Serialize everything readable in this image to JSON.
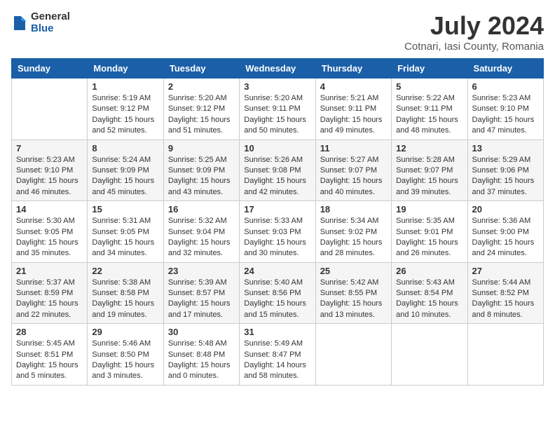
{
  "logo": {
    "general": "General",
    "blue": "Blue"
  },
  "title": "July 2024",
  "subtitle": "Cotnari, Iasi County, Romania",
  "days_of_week": [
    "Sunday",
    "Monday",
    "Tuesday",
    "Wednesday",
    "Thursday",
    "Friday",
    "Saturday"
  ],
  "weeks": [
    [
      {
        "day": "",
        "content": ""
      },
      {
        "day": "1",
        "content": "Sunrise: 5:19 AM\nSunset: 9:12 PM\nDaylight: 15 hours\nand 52 minutes."
      },
      {
        "day": "2",
        "content": "Sunrise: 5:20 AM\nSunset: 9:12 PM\nDaylight: 15 hours\nand 51 minutes."
      },
      {
        "day": "3",
        "content": "Sunrise: 5:20 AM\nSunset: 9:11 PM\nDaylight: 15 hours\nand 50 minutes."
      },
      {
        "day": "4",
        "content": "Sunrise: 5:21 AM\nSunset: 9:11 PM\nDaylight: 15 hours\nand 49 minutes."
      },
      {
        "day": "5",
        "content": "Sunrise: 5:22 AM\nSunset: 9:11 PM\nDaylight: 15 hours\nand 48 minutes."
      },
      {
        "day": "6",
        "content": "Sunrise: 5:23 AM\nSunset: 9:10 PM\nDaylight: 15 hours\nand 47 minutes."
      }
    ],
    [
      {
        "day": "7",
        "content": "Sunrise: 5:23 AM\nSunset: 9:10 PM\nDaylight: 15 hours\nand 46 minutes."
      },
      {
        "day": "8",
        "content": "Sunrise: 5:24 AM\nSunset: 9:09 PM\nDaylight: 15 hours\nand 45 minutes."
      },
      {
        "day": "9",
        "content": "Sunrise: 5:25 AM\nSunset: 9:09 PM\nDaylight: 15 hours\nand 43 minutes."
      },
      {
        "day": "10",
        "content": "Sunrise: 5:26 AM\nSunset: 9:08 PM\nDaylight: 15 hours\nand 42 minutes."
      },
      {
        "day": "11",
        "content": "Sunrise: 5:27 AM\nSunset: 9:07 PM\nDaylight: 15 hours\nand 40 minutes."
      },
      {
        "day": "12",
        "content": "Sunrise: 5:28 AM\nSunset: 9:07 PM\nDaylight: 15 hours\nand 39 minutes."
      },
      {
        "day": "13",
        "content": "Sunrise: 5:29 AM\nSunset: 9:06 PM\nDaylight: 15 hours\nand 37 minutes."
      }
    ],
    [
      {
        "day": "14",
        "content": "Sunrise: 5:30 AM\nSunset: 9:05 PM\nDaylight: 15 hours\nand 35 minutes."
      },
      {
        "day": "15",
        "content": "Sunrise: 5:31 AM\nSunset: 9:05 PM\nDaylight: 15 hours\nand 34 minutes."
      },
      {
        "day": "16",
        "content": "Sunrise: 5:32 AM\nSunset: 9:04 PM\nDaylight: 15 hours\nand 32 minutes."
      },
      {
        "day": "17",
        "content": "Sunrise: 5:33 AM\nSunset: 9:03 PM\nDaylight: 15 hours\nand 30 minutes."
      },
      {
        "day": "18",
        "content": "Sunrise: 5:34 AM\nSunset: 9:02 PM\nDaylight: 15 hours\nand 28 minutes."
      },
      {
        "day": "19",
        "content": "Sunrise: 5:35 AM\nSunset: 9:01 PM\nDaylight: 15 hours\nand 26 minutes."
      },
      {
        "day": "20",
        "content": "Sunrise: 5:36 AM\nSunset: 9:00 PM\nDaylight: 15 hours\nand 24 minutes."
      }
    ],
    [
      {
        "day": "21",
        "content": "Sunrise: 5:37 AM\nSunset: 8:59 PM\nDaylight: 15 hours\nand 22 minutes."
      },
      {
        "day": "22",
        "content": "Sunrise: 5:38 AM\nSunset: 8:58 PM\nDaylight: 15 hours\nand 19 minutes."
      },
      {
        "day": "23",
        "content": "Sunrise: 5:39 AM\nSunset: 8:57 PM\nDaylight: 15 hours\nand 17 minutes."
      },
      {
        "day": "24",
        "content": "Sunrise: 5:40 AM\nSunset: 8:56 PM\nDaylight: 15 hours\nand 15 minutes."
      },
      {
        "day": "25",
        "content": "Sunrise: 5:42 AM\nSunset: 8:55 PM\nDaylight: 15 hours\nand 13 minutes."
      },
      {
        "day": "26",
        "content": "Sunrise: 5:43 AM\nSunset: 8:54 PM\nDaylight: 15 hours\nand 10 minutes."
      },
      {
        "day": "27",
        "content": "Sunrise: 5:44 AM\nSunset: 8:52 PM\nDaylight: 15 hours\nand 8 minutes."
      }
    ],
    [
      {
        "day": "28",
        "content": "Sunrise: 5:45 AM\nSunset: 8:51 PM\nDaylight: 15 hours\nand 5 minutes."
      },
      {
        "day": "29",
        "content": "Sunrise: 5:46 AM\nSunset: 8:50 PM\nDaylight: 15 hours\nand 3 minutes."
      },
      {
        "day": "30",
        "content": "Sunrise: 5:48 AM\nSunset: 8:48 PM\nDaylight: 15 hours\nand 0 minutes."
      },
      {
        "day": "31",
        "content": "Sunrise: 5:49 AM\nSunset: 8:47 PM\nDaylight: 14 hours\nand 58 minutes."
      },
      {
        "day": "",
        "content": ""
      },
      {
        "day": "",
        "content": ""
      },
      {
        "day": "",
        "content": ""
      }
    ]
  ]
}
